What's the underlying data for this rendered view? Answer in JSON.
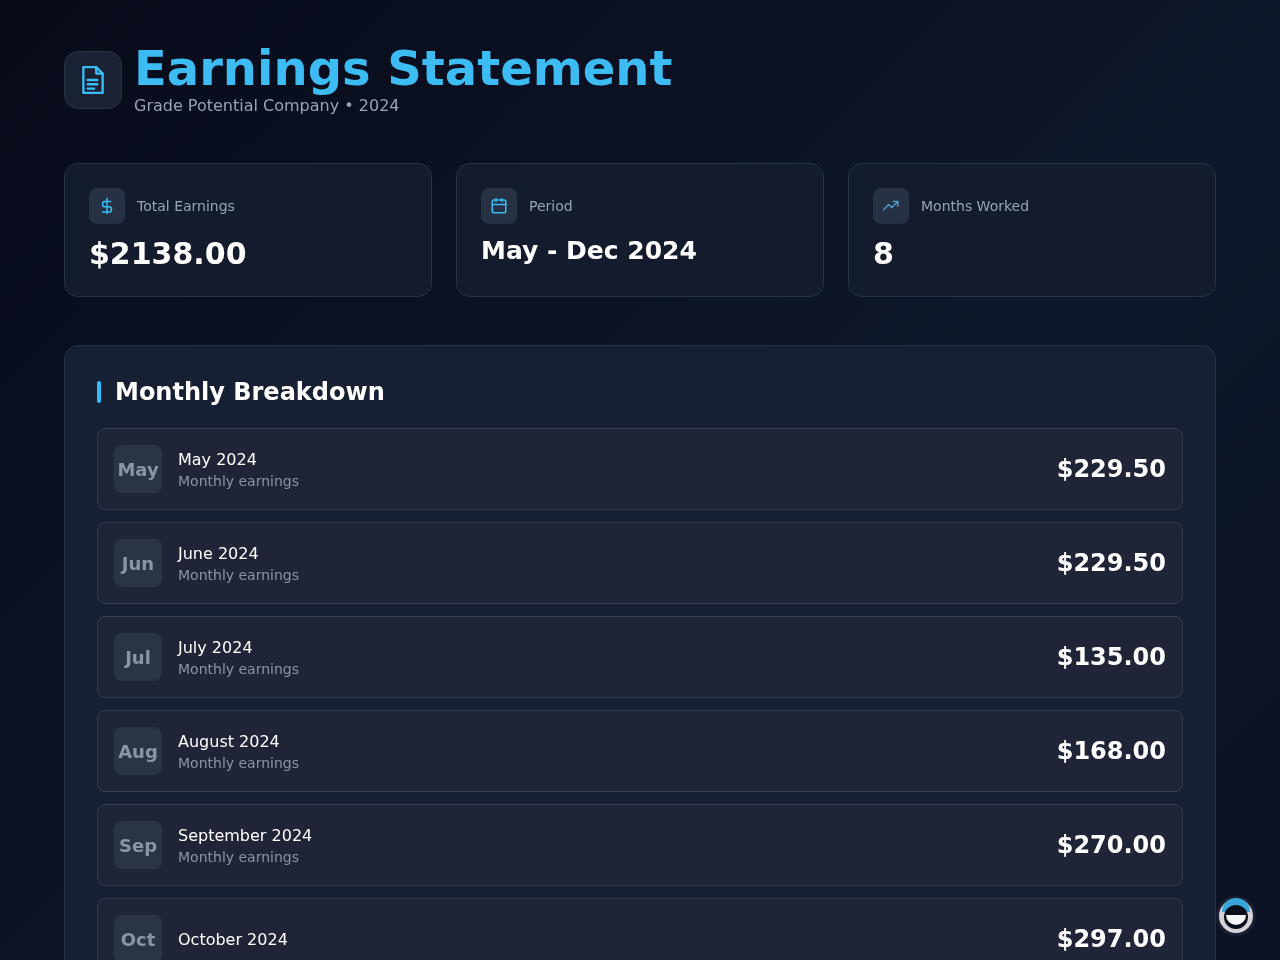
{
  "header": {
    "title": "Earnings Statement",
    "subtitle": "Grade Potential Company • 2024"
  },
  "stats": [
    {
      "kind": "dollar",
      "label": "Total Earnings",
      "value": "$2138.00"
    },
    {
      "kind": "calendar",
      "label": "Period",
      "value": "May - Dec 2024"
    },
    {
      "kind": "trend",
      "label": "Months Worked",
      "value": "8"
    }
  ],
  "breakdown": {
    "title": "Monthly Breakdown",
    "rows": [
      {
        "abbr": "May",
        "month": "May 2024",
        "note": "Monthly earnings",
        "amount": "$229.50"
      },
      {
        "abbr": "Jun",
        "month": "June 2024",
        "note": "Monthly earnings",
        "amount": "$229.50"
      },
      {
        "abbr": "Jul",
        "month": "July 2024",
        "note": "Monthly earnings",
        "amount": "$135.00"
      },
      {
        "abbr": "Aug",
        "month": "August 2024",
        "note": "Monthly earnings",
        "amount": "$168.00"
      },
      {
        "abbr": "Sep",
        "month": "September 2024",
        "note": "Monthly earnings",
        "amount": "$270.00"
      },
      {
        "abbr": "Oct",
        "month": "October 2024",
        "amount": "$297.00"
      }
    ]
  }
}
